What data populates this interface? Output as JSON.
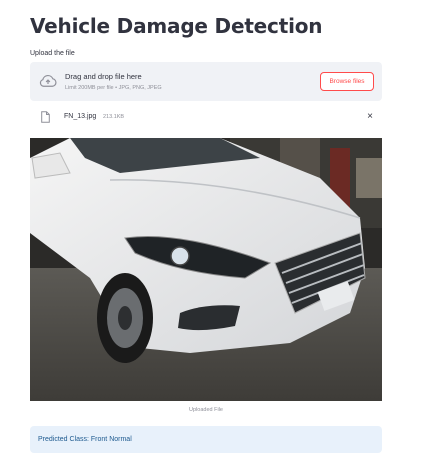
{
  "header": {
    "title": "Vehicle Damage Detection"
  },
  "uploader": {
    "label": "Upload the file",
    "drop_text": "Drag and drop file here",
    "limit_text": "Limit 200MB per file • JPG, PNG, JPEG",
    "browse_label": "Browse files",
    "cloud_icon": "cloud-upload-icon"
  },
  "file": {
    "name": "FN_13.jpg",
    "size": "213.1KB",
    "icon": "file-icon",
    "remove_label": "×"
  },
  "image": {
    "caption": "Uploaded File"
  },
  "result": {
    "text": "Predicted Class: Front Normal"
  },
  "colors": {
    "accent": "#ff4b4b",
    "dropzone_bg": "#f0f2f6",
    "alert_bg": "#e8f1fb",
    "alert_text": "#1e5a8f"
  }
}
